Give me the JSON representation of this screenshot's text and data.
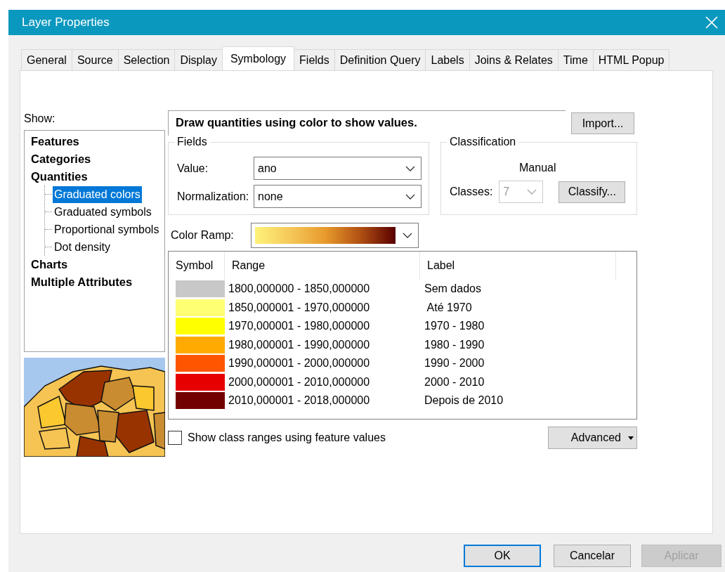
{
  "window": {
    "title": "Layer Properties"
  },
  "tabs": [
    {
      "label": "General",
      "selected": false
    },
    {
      "label": "Source",
      "selected": false
    },
    {
      "label": "Selection",
      "selected": false
    },
    {
      "label": "Display",
      "selected": false
    },
    {
      "label": "Symbology",
      "selected": true
    },
    {
      "label": "Fields",
      "selected": false
    },
    {
      "label": "Definition Query",
      "selected": false
    },
    {
      "label": "Labels",
      "selected": false
    },
    {
      "label": "Joins & Relates",
      "selected": false
    },
    {
      "label": "Time",
      "selected": false
    },
    {
      "label": "HTML Popup",
      "selected": false
    }
  ],
  "show": {
    "label": "Show:",
    "tree": [
      {
        "label": "Features",
        "selected": false
      },
      {
        "label": "Categories",
        "selected": false
      },
      {
        "label": "Quantities",
        "selected": false,
        "children": [
          {
            "label": "Graduated colors",
            "selected": true
          },
          {
            "label": "Graduated symbols",
            "selected": false
          },
          {
            "label": "Proportional symbols",
            "selected": false
          },
          {
            "label": "Dot density",
            "selected": false
          }
        ]
      },
      {
        "label": "Charts",
        "selected": false
      },
      {
        "label": "Multiple Attributes",
        "selected": false
      }
    ]
  },
  "description": "Draw quantities using color to show values.",
  "import_button": "Import...",
  "fields": {
    "title": "Fields",
    "value_label": "Value:",
    "value": "ano",
    "normalization_label": "Normalization:",
    "normalization": "none"
  },
  "classification": {
    "title": "Classification",
    "method": "Manual",
    "classes_label": "Classes:",
    "classes": "7",
    "classes_disabled": true,
    "classify_button": "Classify..."
  },
  "color_ramp": {
    "label": "Color Ramp:"
  },
  "table": {
    "columns": [
      "Symbol",
      "Range",
      "Label"
    ],
    "rows": [
      {
        "color": "#c8c8c8",
        "range": "1800,000000 - 1850,000000",
        "label": "Sem dados"
      },
      {
        "color": "#ffff73",
        "range": "1850,000001 - 1970,000000",
        "label": " Até 1970"
      },
      {
        "color": "#ffff00",
        "range": "1970,000001 - 1980,000000",
        "label": "1970 - 1980"
      },
      {
        "color": "#ffaa00",
        "range": "1980,000001 - 1990,000000",
        "label": "1980 - 1990"
      },
      {
        "color": "#ff5500",
        "range": "1990,000001 - 2000,000000",
        "label": "1990 - 2000"
      },
      {
        "color": "#e60000",
        "range": "2000,000001 - 2010,000000",
        "label": "2000 - 2010"
      },
      {
        "color": "#730000",
        "range": "2010,000001 - 2018,000000",
        "label": "Depois de 2010"
      }
    ]
  },
  "feature_values_checkbox": {
    "label": "Show class ranges using feature values",
    "checked": false
  },
  "advanced_button": "Advanced",
  "buttons": [
    {
      "label": "OK",
      "default": true,
      "disabled": false
    },
    {
      "label": "Cancelar",
      "default": false,
      "disabled": false
    },
    {
      "label": "Aplicar",
      "default": false,
      "disabled": true
    }
  ]
}
